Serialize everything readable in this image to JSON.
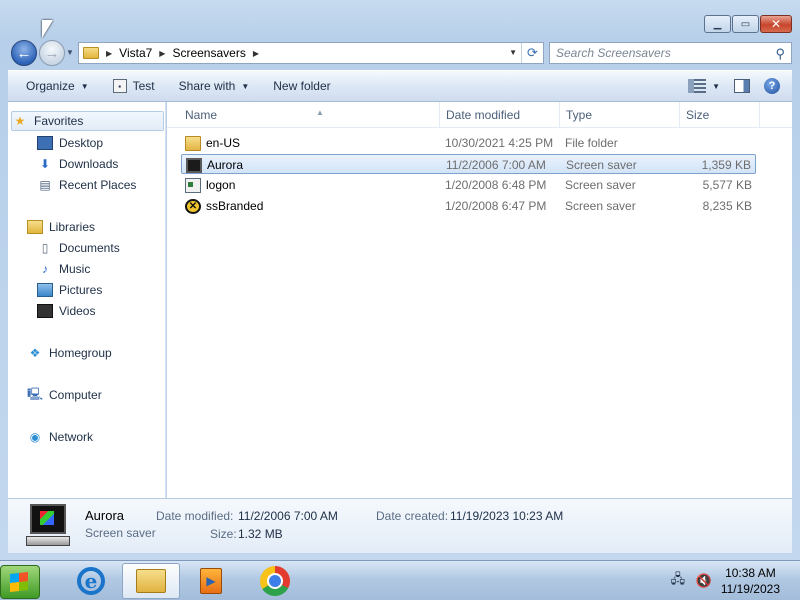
{
  "address": {
    "crumbs": [
      "Vista7",
      "Screensavers"
    ],
    "search_placeholder": "Search Screensavers"
  },
  "toolbar": {
    "organize": "Organize",
    "test": "Test",
    "share_with": "Share with",
    "new_folder": "New folder"
  },
  "nav": {
    "favorites": "Favorites",
    "desktop": "Desktop",
    "downloads": "Downloads",
    "recent_places": "Recent Places",
    "libraries": "Libraries",
    "documents": "Documents",
    "music": "Music",
    "pictures": "Pictures",
    "videos": "Videos",
    "homegroup": "Homegroup",
    "computer": "Computer",
    "network": "Network"
  },
  "columns": {
    "name": "Name",
    "date": "Date modified",
    "type": "Type",
    "size": "Size"
  },
  "files": [
    {
      "name": "en-US",
      "date": "10/30/2021 4:25 PM",
      "type": "File folder",
      "size": "",
      "icon": "folder-icon"
    },
    {
      "name": "Aurora",
      "date": "11/2/2006 7:00 AM",
      "type": "Screen saver",
      "size": "1,359 KB",
      "icon": "monitor-icon"
    },
    {
      "name": "logon",
      "date": "1/20/2008 6:48 PM",
      "type": "Screen saver",
      "size": "5,577 KB",
      "icon": "logon-icon"
    },
    {
      "name": "ssBranded",
      "date": "1/20/2008 6:47 PM",
      "type": "Screen saver",
      "size": "8,235 KB",
      "icon": "windows-logo-icon"
    }
  ],
  "details": {
    "name": "Aurora",
    "type": "Screen saver",
    "date_modified_label": "Date modified:",
    "date_modified": "11/2/2006 7:00 AM",
    "date_created_label": "Date created:",
    "date_created": "11/19/2023 10:23 AM",
    "size_label": "Size:",
    "size": "1.32 MB"
  },
  "taskbar": {
    "time": "10:38 AM",
    "date": "11/19/2023"
  }
}
